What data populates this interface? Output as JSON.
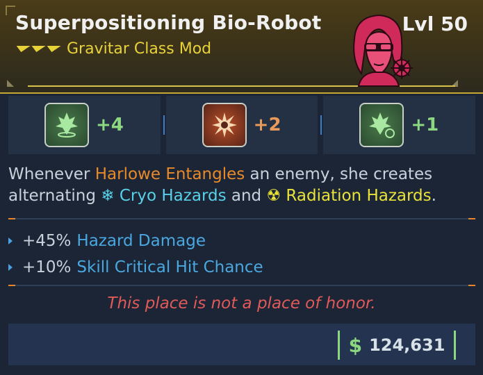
{
  "header": {
    "item_name": "Superpositioning Bio-Robot",
    "class_mod": "Gravitar Class Mod",
    "level": "Lvl 50",
    "colors": {
      "accent": "#e8d23a",
      "header_bg": "#4a3c18"
    }
  },
  "skills": [
    {
      "icon": "skill-tree-green-icon",
      "value": "+4"
    },
    {
      "icon": "skill-explosion-red-icon",
      "value": "+2"
    },
    {
      "icon": "skill-grenade-green-icon",
      "value": "+1"
    }
  ],
  "description": {
    "part1": "Whenever ",
    "harlowe": "Harlowe Entangles",
    "part2": " an enemy, she creates alternating ",
    "cryo": "Cryo Hazards",
    "part3": " and ",
    "rad": "Radiation Hazards",
    "part4": "."
  },
  "stats": [
    {
      "num": "+45%",
      "label": "Hazard Damage"
    },
    {
      "num": "+10%",
      "label": "Skill Critical Hit Chance"
    }
  ],
  "flavor": "This place is not a place of honor.",
  "price": {
    "symbol": "$",
    "amount": "124,631"
  }
}
